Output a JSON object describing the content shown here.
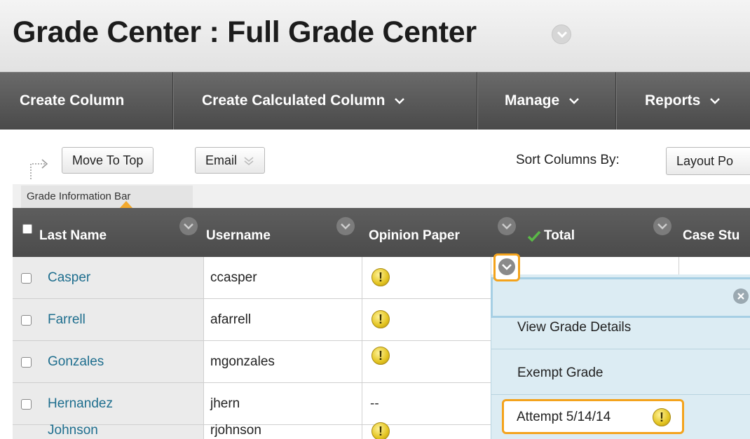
{
  "page_title": "Grade Center : Full Grade Center",
  "action_bar": {
    "create_column": "Create Column",
    "create_calculated_column": "Create Calculated Column",
    "manage": "Manage",
    "reports": "Reports"
  },
  "toolbar": {
    "move_to_top": "Move To Top",
    "email": "Email",
    "sort_columns_by": "Sort Columns By:",
    "sort_value": "Layout Po"
  },
  "grade_info_bar": "Grade Information Bar",
  "columns": {
    "last_name": "Last Name",
    "username": "Username",
    "opinion_paper": "Opinion Paper",
    "total": "Total",
    "case_study": "Case Stu"
  },
  "rows": [
    {
      "last_name": "Casper",
      "username": "ccasper",
      "opinion_paper": "!",
      "total": "--",
      "case_study": "--"
    },
    {
      "last_name": "Farrell",
      "username": "afarrell",
      "opinion_paper": "!"
    },
    {
      "last_name": "Gonzales",
      "username": "mgonzales",
      "opinion_paper": "!"
    },
    {
      "last_name": "Hernandez",
      "username": "jhern",
      "opinion_paper": "--"
    },
    {
      "last_name": "Johnson",
      "username": "rjohnson",
      "opinion_paper": "!"
    }
  ],
  "dropdown": {
    "items": [
      "View Grade Details",
      "Exempt Grade"
    ],
    "attempt": "Attempt 5/14/14",
    "attempt_badge": "!"
  },
  "icons": {
    "menu_chevron": "chevron-down-icon",
    "needs_grading": "exclamation-icon",
    "total_check": "green-check-icon",
    "clear": "close-icon",
    "move_arrow": "arrow-right-icon"
  },
  "colors": {
    "accent_orange": "#f4a31c",
    "link_blue": "#1e6e8e",
    "header_dark": "#4b4b4b",
    "dropdown_bg": "#dcecf3",
    "needs_grade_yellow": "#e3c420",
    "check_green": "#5ab947"
  }
}
